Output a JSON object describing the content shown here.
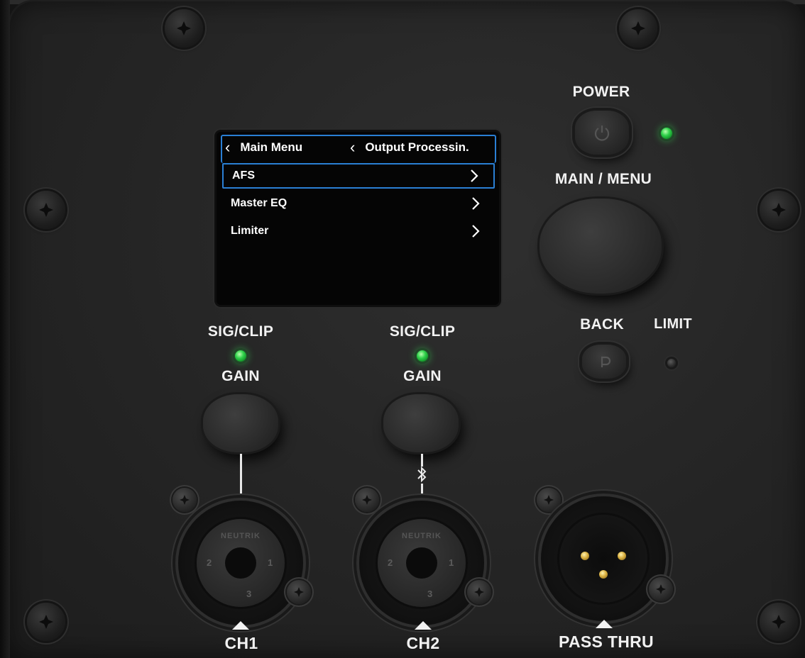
{
  "screen": {
    "breadcrumb_1": "Main Menu",
    "breadcrumb_2": "Output Processin.",
    "items": [
      {
        "label": "AFS",
        "selected": true
      },
      {
        "label": "Master EQ",
        "selected": false
      },
      {
        "label": "Limiter",
        "selected": false
      }
    ]
  },
  "controls": {
    "power_label": "POWER",
    "main_menu_label": "MAIN / MENU",
    "back_label": "BACK",
    "limit_label": "LIMIT",
    "ch1_sig_label": "SIG/CLIP",
    "ch1_gain_label": "GAIN",
    "ch2_sig_label": "SIG/CLIP",
    "ch2_gain_label": "GAIN"
  },
  "connectors": {
    "ch1_label": "CH1",
    "ch2_label": "CH2",
    "pass_thru_label": "PASS THRU",
    "combo_brand": "NEUTRIK",
    "pin_1": "1",
    "pin_2": "2",
    "pin_3": "3"
  },
  "leds": {
    "power": "on",
    "ch1_sig": "on",
    "ch2_sig": "on",
    "limit": "off"
  },
  "colors": {
    "led_green": "#2fd14a",
    "screen_accent": "#2a7fd4"
  },
  "icons": {
    "power_button": "power-icon",
    "back_button": "back-icon",
    "ch2_link": "bluetooth-icon"
  }
}
